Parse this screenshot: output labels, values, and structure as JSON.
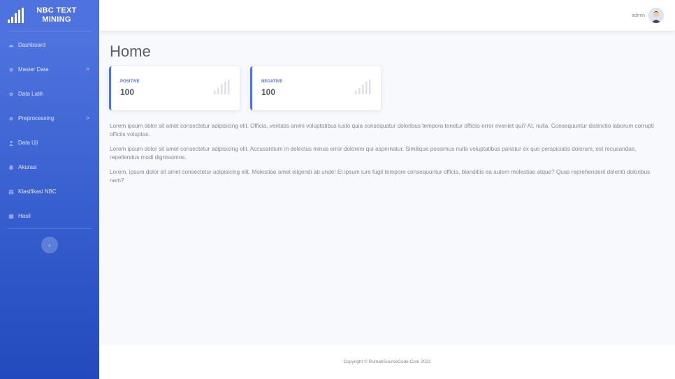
{
  "brand": {
    "line1": "NBC TEXT",
    "line2": "MINING"
  },
  "sidebar": {
    "items": [
      {
        "label": "Dashboard",
        "icon": "dashboard-icon",
        "has_submenu": false
      },
      {
        "label": "Master Data",
        "icon": "cog-icon",
        "has_submenu": true
      },
      {
        "label": "Data Latih",
        "icon": "cog-icon",
        "has_submenu": false
      },
      {
        "label": "Preprocessing",
        "icon": "cog-icon",
        "has_submenu": true
      },
      {
        "label": "Data Uji",
        "icon": "user-icon",
        "has_submenu": false
      },
      {
        "label": "Akurasi",
        "icon": "bell-icon",
        "has_submenu": false
      },
      {
        "label": "Klasifikasi NBC",
        "icon": "table-icon",
        "has_submenu": false
      },
      {
        "label": "Hasil",
        "icon": "calendar-icon",
        "has_submenu": false
      }
    ],
    "chevron": ">",
    "toggle": "‹"
  },
  "topbar": {
    "user_name": "admin"
  },
  "page": {
    "title": "Home"
  },
  "cards": [
    {
      "label": "POSITIVE",
      "value": "100"
    },
    {
      "label": "NEGATIVE",
      "value": "100"
    }
  ],
  "paragraphs": [
    "Lorem ipsum dolor sit amet consectetur adipisicing elit. Officia, veritatis animi voluptatibus iusto quia consequatur doloribus tempora tenetur officiis error eveniet qui? At, nulla. Consequuntur distinctio laborum corrupti officiis voluptas.",
    "Lorem ipsum dolor sit amet consectetur adipisicing elit. Accusantium in delectus minus error dolorem qui aspernatur. Similique possimus nulla voluptatibus pariatur ex quo perspiciatis dolorum, est recusandae, repellendus modi dignissimos.",
    "Lorem, ipsum dolor sit amet consectetur adipisicing elit. Molestiae amet eligendi ab unde! Et ipsum iure fugit tempore consequuntur officia, blanditiis ea autem molestiae atque? Quas reprehenderit deleniti doloribus nam?"
  ],
  "footer": {
    "copyright": "Copyright © RumahSourceCode.Com 2022"
  },
  "colors": {
    "primary": "#4e73df",
    "primary_dark": "#224abe",
    "text": "#858796",
    "heading": "#5a5c69",
    "background": "#f8f9fc"
  }
}
